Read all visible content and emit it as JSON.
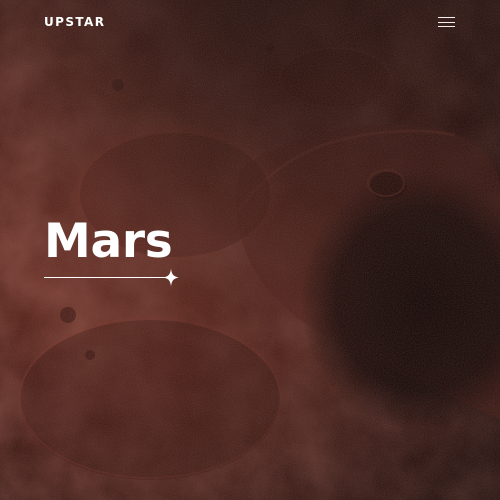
{
  "header": {
    "logo_text": "UPSTAR",
    "menu_icon": "hamburger-menu-icon"
  },
  "hero": {
    "title": "Mars",
    "divider_icon": "sparkle-star-icon"
  },
  "colors": {
    "surface_base": "#3a1712",
    "surface_highlight": "#8a3f33",
    "shadow": "#0c0605",
    "text": "#ffffff"
  }
}
